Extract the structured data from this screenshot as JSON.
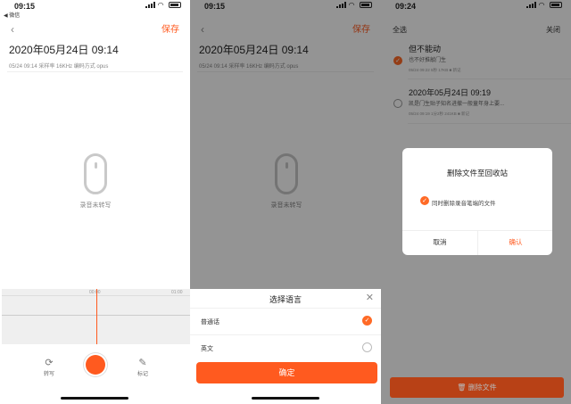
{
  "screen1": {
    "status": {
      "time": "09:15",
      "carrier": "◀ 微信"
    },
    "nav": {
      "back_icon": "‹",
      "save_label": "保存"
    },
    "recording": {
      "title": "2020年05月24日 09:14",
      "meta": "05/24 09:14    采样率 16KHz  编码方式 opus"
    },
    "empty_caption": "录音未转写",
    "waveform": {
      "tick_left": "00:00",
      "tick_right": "01:00"
    },
    "toolbar": {
      "transcribe_label": "转写",
      "mark_label": "标记"
    }
  },
  "screen2": {
    "status": {
      "time": "09:15"
    },
    "nav": {
      "back_icon": "‹",
      "save_label": "保存"
    },
    "recording": {
      "title": "2020年05月24日 09:14",
      "meta": "05/24 09:14    采样率 16KHz  编码方式 opus"
    },
    "empty_caption": "录音未转写",
    "language_sheet": {
      "title": "选择语言",
      "close_icon": "✕",
      "options": [
        {
          "label": "普通话",
          "selected": true
        },
        {
          "label": "英文",
          "selected": false
        }
      ],
      "confirm_label": "确定"
    }
  },
  "screen3": {
    "status": {
      "time": "09:24"
    },
    "header": {
      "select_all_label": "全选",
      "close_label": "关闭"
    },
    "items": [
      {
        "title": "但不能动",
        "snippet": "也不好推敲门生",
        "meta": "05/24 09:22  5秒  17KB  ■ 新记",
        "checked": true
      },
      {
        "title": "2020年05月24日 09:19",
        "snippet": "凯是门生贴子知名进撤一般童年身上要...",
        "meta": "05/24 09:19  1分2秒  241KB  ■ 新记",
        "checked": false
      }
    ],
    "dialog": {
      "title": "删除文件至回收站",
      "option_label": "同时删除录音笔端的文件",
      "cancel_label": "取消",
      "confirm_label": "确认"
    },
    "delete_label": "删除文件",
    "accent_color": "#ff5a1f"
  }
}
